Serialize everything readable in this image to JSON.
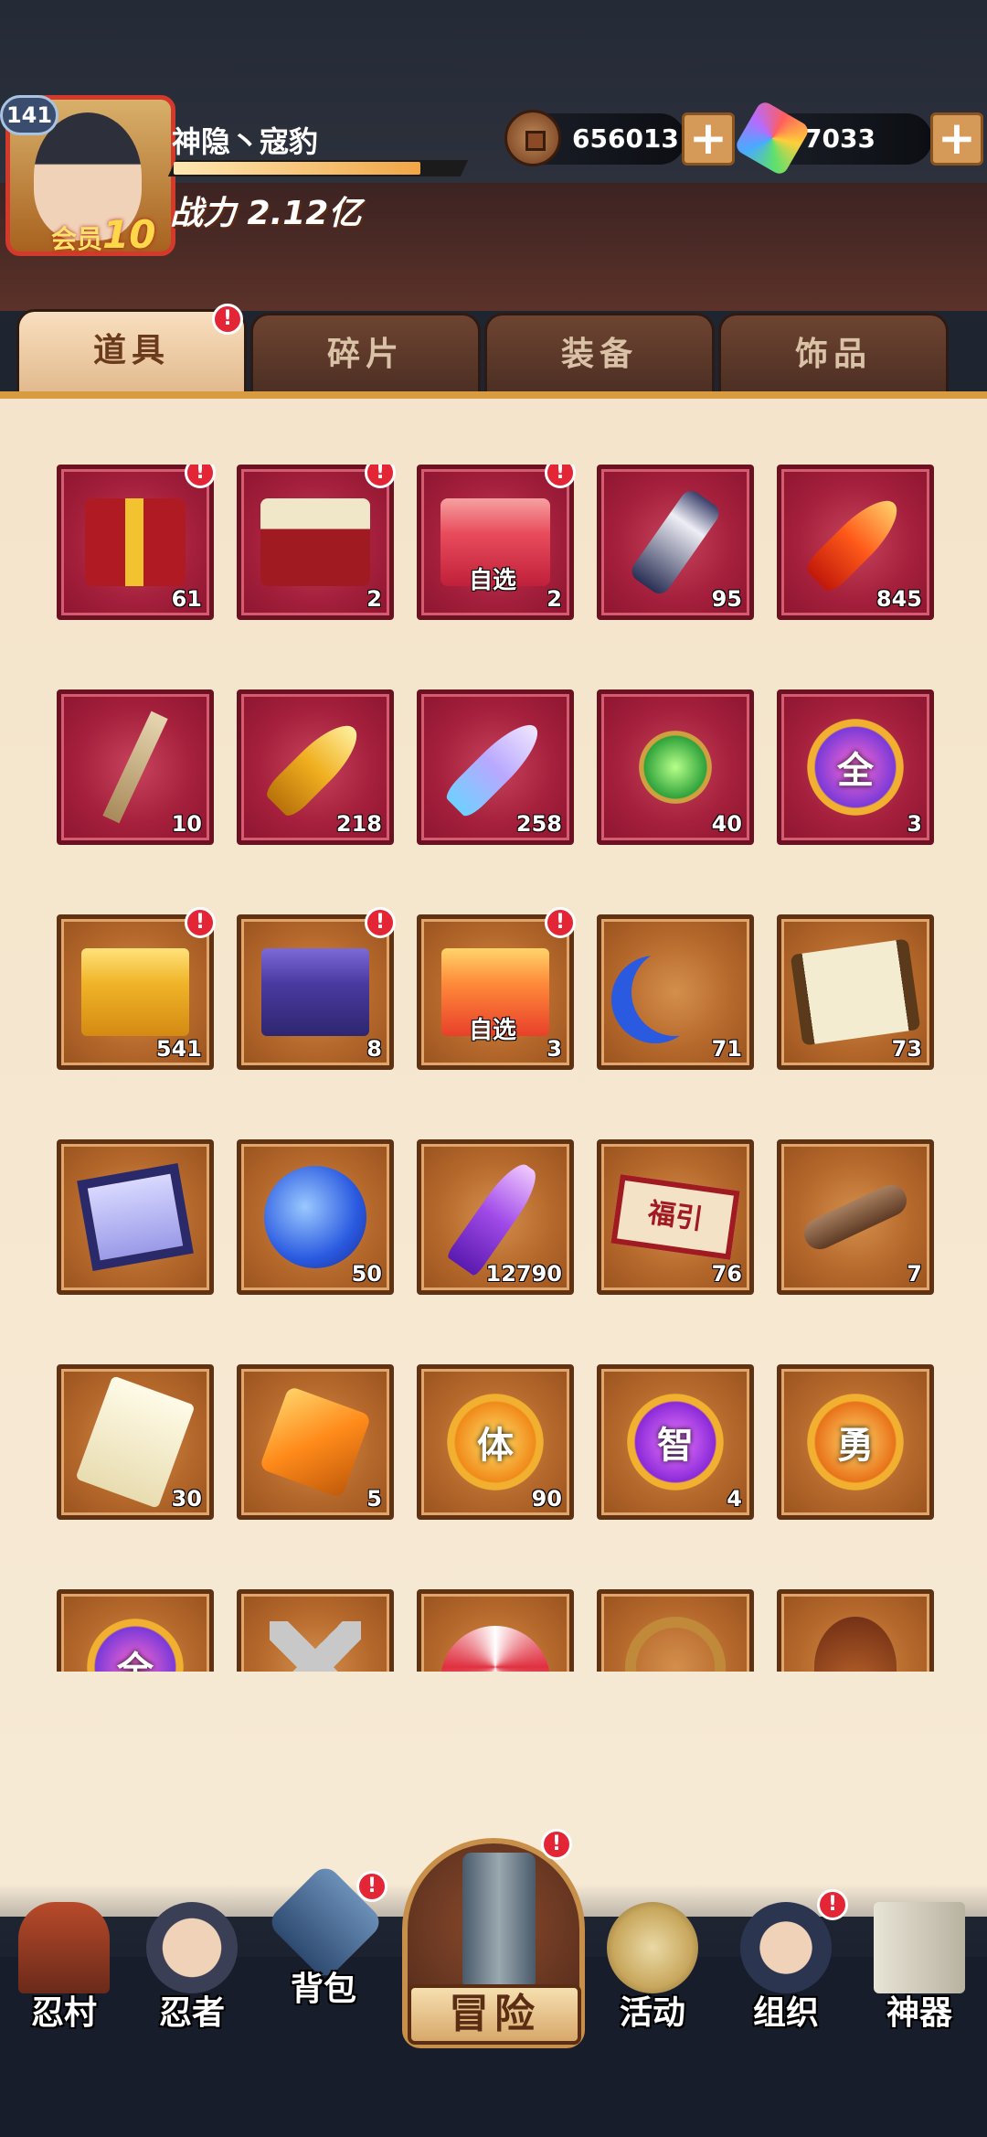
{
  "player": {
    "level": "141",
    "name": "神隐丶寇豹",
    "vip_label": "会员",
    "vip_level": "10",
    "power": "战力 2.12亿"
  },
  "currency": {
    "coins": "656013",
    "gems": "7033",
    "add_label": "+"
  },
  "tabs": [
    {
      "label": "道具",
      "active": true,
      "badge": "!"
    },
    {
      "label": "碎片",
      "active": false
    },
    {
      "label": "装备",
      "active": false
    },
    {
      "label": "饰品",
      "active": false
    }
  ],
  "items": [
    {
      "icon": "gift-box-icon",
      "count": "61",
      "frame": "red",
      "badge": "!"
    },
    {
      "icon": "treasure-chest-icon",
      "count": "2",
      "frame": "red",
      "badge": "!"
    },
    {
      "icon": "selectable-box-icon",
      "count": "2",
      "frame": "red",
      "badge": "!",
      "tag": "自选"
    },
    {
      "icon": "scroll-icon",
      "count": "95",
      "frame": "red"
    },
    {
      "icon": "red-feather-icon",
      "count": "845",
      "frame": "red"
    },
    {
      "icon": "stick-icon",
      "count": "10",
      "frame": "red"
    },
    {
      "icon": "gold-feather-icon",
      "count": "218",
      "frame": "red"
    },
    {
      "icon": "blue-feather-icon",
      "count": "258",
      "frame": "red"
    },
    {
      "icon": "jade-pendant-icon",
      "count": "40",
      "frame": "red"
    },
    {
      "icon": "orb-all-icon",
      "count": "3",
      "frame": "red",
      "glyph": "全"
    },
    {
      "icon": "gold-box-icon",
      "count": "541",
      "frame": "brown",
      "badge": "!"
    },
    {
      "icon": "purple-box-icon",
      "count": "8",
      "frame": "brown",
      "badge": "!"
    },
    {
      "icon": "selectable-orange-box-icon",
      "count": "3",
      "frame": "brown",
      "badge": "!",
      "tag": "自选"
    },
    {
      "icon": "blue-moon-icon",
      "count": "71",
      "frame": "brown"
    },
    {
      "icon": "map-scroll-icon",
      "count": "73",
      "frame": "brown"
    },
    {
      "icon": "blue-flag-icon",
      "count": "",
      "frame": "brown"
    },
    {
      "icon": "blue-sphere-icon",
      "count": "50",
      "frame": "brown"
    },
    {
      "icon": "purple-crystal-icon",
      "count": "12790",
      "frame": "brown"
    },
    {
      "icon": "lucky-banner-icon",
      "count": "76",
      "frame": "brown",
      "glyph": "福引"
    },
    {
      "icon": "key-icon",
      "count": "7",
      "frame": "brown"
    },
    {
      "icon": "paper-note-icon",
      "count": "30",
      "frame": "brown"
    },
    {
      "icon": "amber-gem-icon",
      "count": "5",
      "frame": "brown"
    },
    {
      "icon": "orb-body-icon",
      "count": "90",
      "frame": "brown",
      "glyph": "体"
    },
    {
      "icon": "orb-wisdom-icon",
      "count": "4",
      "frame": "brown",
      "glyph": "智"
    },
    {
      "icon": "orb-courage-icon",
      "count": "",
      "frame": "brown",
      "glyph": "勇"
    },
    {
      "icon": "orb-all-icon",
      "count": "",
      "frame": "brown",
      "glyph": "全"
    },
    {
      "icon": "shuriken-icon",
      "count": "",
      "frame": "brown"
    },
    {
      "icon": "fan-icon",
      "count": "",
      "frame": "brown"
    },
    {
      "icon": "rope-icon",
      "count": "",
      "frame": "brown"
    },
    {
      "icon": "gourd-icon",
      "count": "",
      "frame": "brown"
    }
  ],
  "nav": [
    {
      "label": "忍村",
      "icon": "village-gate-icon"
    },
    {
      "label": "忍者",
      "icon": "ninja-icon"
    },
    {
      "label": "背包",
      "icon": "backpack-icon",
      "badge": "!"
    },
    {
      "label": "冒险",
      "icon": "adventure-scroll-icon",
      "badge": "!"
    },
    {
      "label": "活动",
      "icon": "drum-icon"
    },
    {
      "label": "组织",
      "icon": "organization-icon",
      "badge": "!"
    },
    {
      "label": "神器",
      "icon": "artifact-book-icon"
    }
  ],
  "colors": {
    "red_frame": "#a5203c",
    "brown_frame": "#b5682b",
    "badge": "#e42535",
    "tab_active": "#f2cfa5"
  }
}
